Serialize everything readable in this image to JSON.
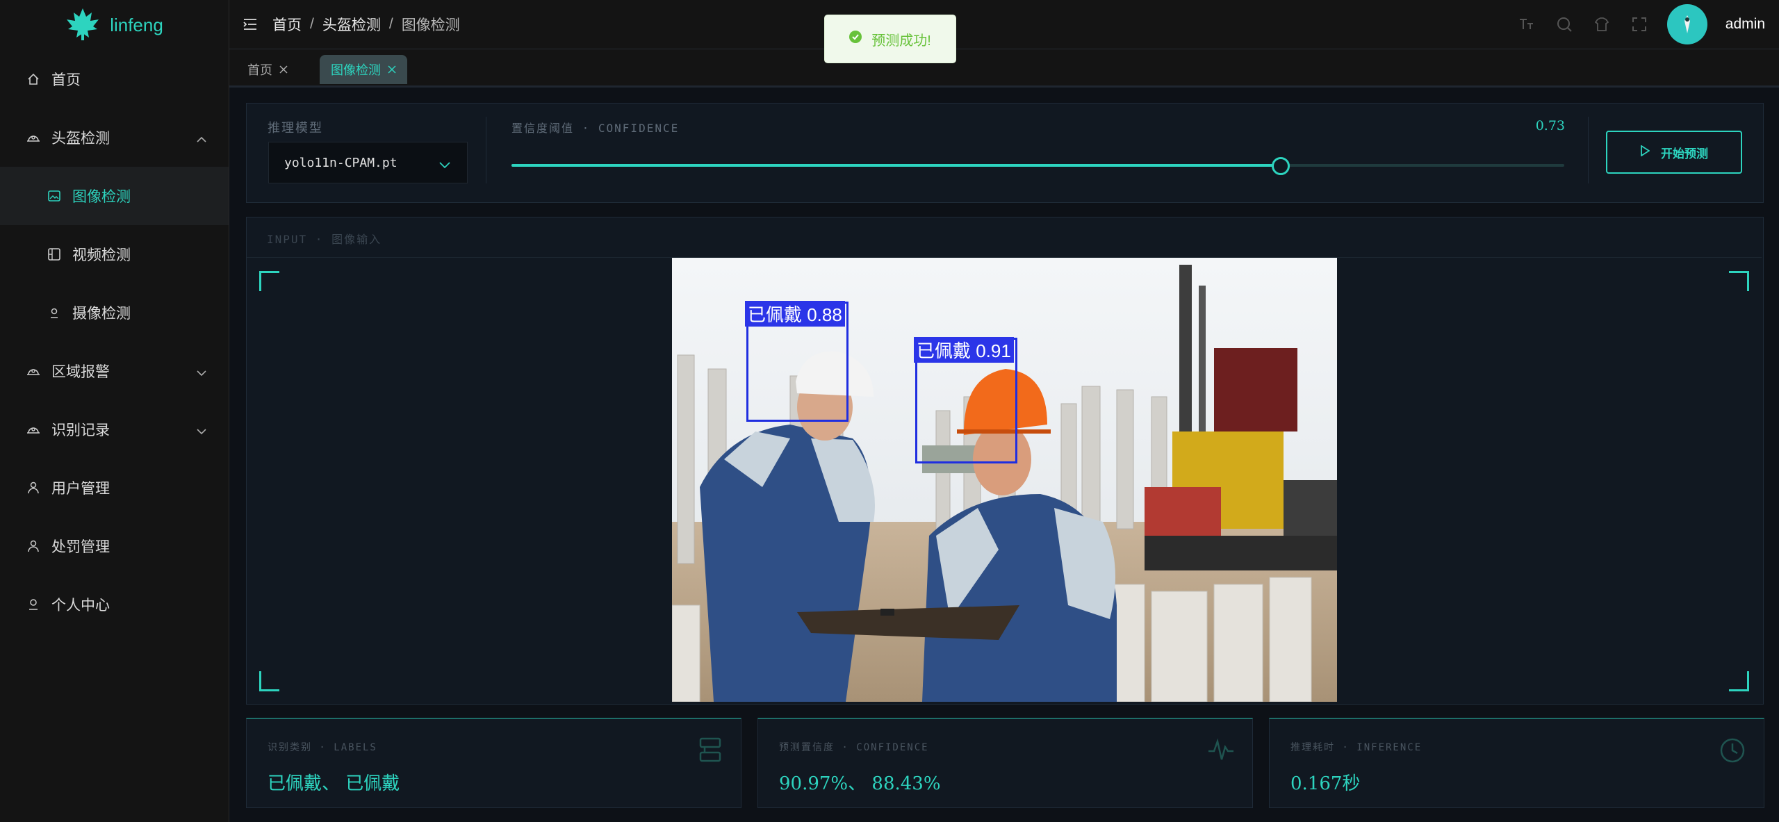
{
  "app": {
    "name": "linfeng"
  },
  "sidebar": {
    "items": [
      {
        "label": "首页",
        "icon": "home-icon"
      },
      {
        "label": "头盔检测",
        "icon": "helmet-icon"
      },
      {
        "label": "图像检测",
        "icon": "image-icon"
      },
      {
        "label": "视频检测",
        "icon": "video-icon"
      },
      {
        "label": "摄像检测",
        "icon": "camera-icon"
      },
      {
        "label": "区域报警",
        "icon": "alarm-icon"
      },
      {
        "label": "识别记录",
        "icon": "records-icon"
      },
      {
        "label": "用户管理",
        "icon": "user-icon"
      },
      {
        "label": "处罚管理",
        "icon": "punish-icon"
      },
      {
        "label": "个人中心",
        "icon": "profile-icon"
      }
    ]
  },
  "breadcrumb": [
    "首页",
    "头盔检测",
    "图像检测"
  ],
  "user": {
    "name": "admin"
  },
  "tabs": [
    {
      "label": "首页"
    },
    {
      "label": "图像检测"
    }
  ],
  "toast": {
    "message": "预测成功!"
  },
  "controls": {
    "model_label": "推理模型",
    "model_value": "yolo11n-CPAM.pt",
    "confidence_label": "置信度阈值 · CONFIDENCE",
    "confidence_value": "0.73",
    "confidence_fraction": 0.73,
    "start_label": "开始预测"
  },
  "input": {
    "label": "INPUT · 图像输入",
    "detections": [
      {
        "label": "已佩戴 0.88"
      },
      {
        "label": "已佩戴 0.91"
      }
    ]
  },
  "stats": [
    {
      "title": "识别类别 · LABELS",
      "value": "已佩戴、 已佩戴",
      "icon": "labels-icon"
    },
    {
      "title": "预测置信度 · CONFIDENCE",
      "value": "90.97%、 88.43%",
      "icon": "pulse-icon"
    },
    {
      "title": "推理耗时 · INFERENCE",
      "value": "0.167秒",
      "icon": "clock-icon"
    }
  ],
  "colors": {
    "accent": "#2dd4bf",
    "background": "#0d1117",
    "sidebar": "#141414",
    "detection": "#1f2ee0"
  }
}
